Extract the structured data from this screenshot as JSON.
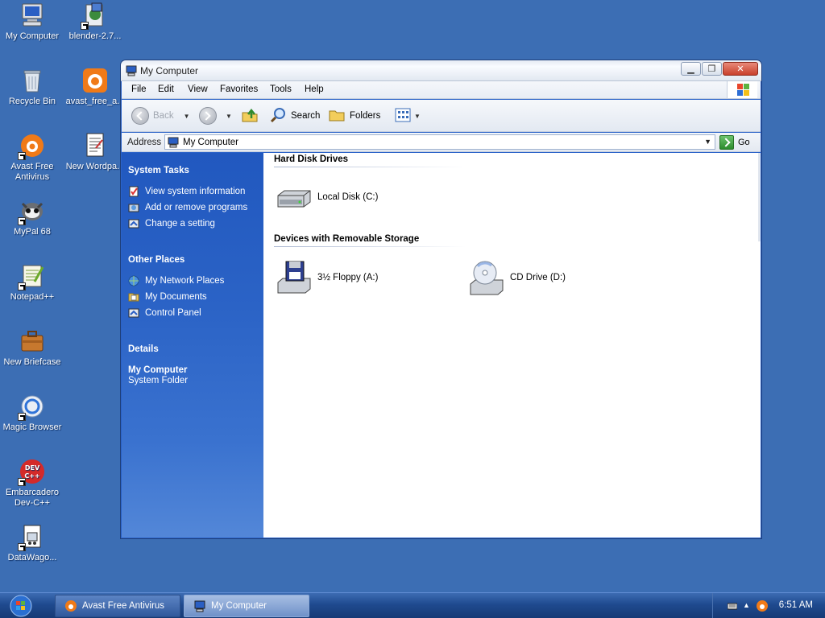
{
  "desktop": {
    "icons": [
      {
        "label": "My Computer",
        "icon": "my-computer-icon"
      },
      {
        "label": "blender-2.7...",
        "icon": "installer-icon"
      },
      {
        "label": "Recycle Bin",
        "icon": "recycle-bin-icon"
      },
      {
        "label": "avast_free_a...",
        "icon": "avast-installer-icon"
      },
      {
        "label": "Avast Free Antivirus",
        "icon": "avast-icon"
      },
      {
        "label": "New Wordpa...",
        "icon": "wordpad-document-icon"
      },
      {
        "label": "MyPal 68",
        "icon": "mypal-browser-icon"
      },
      {
        "label": "Notepad++",
        "icon": "notepadpp-icon"
      },
      {
        "label": "New Briefcase",
        "icon": "briefcase-icon"
      },
      {
        "label": "Magic Browser",
        "icon": "magic-browser-icon"
      },
      {
        "label": "Embarcadero Dev-C++",
        "icon": "devcpp-icon"
      },
      {
        "label": "DataWago...",
        "icon": "datawagon-icon"
      }
    ]
  },
  "window": {
    "title": "My Computer",
    "menu": [
      "File",
      "Edit",
      "View",
      "Favorites",
      "Tools",
      "Help"
    ],
    "toolbar": {
      "back": "Back",
      "search": "Search",
      "folders": "Folders"
    },
    "address": {
      "label": "Address",
      "value": "My Computer",
      "go": "Go"
    },
    "left_pane": {
      "system_tasks": {
        "title": "System Tasks",
        "links": [
          "View system information",
          "Add or remove programs",
          "Change a setting"
        ]
      },
      "other_places": {
        "title": "Other Places",
        "links": [
          "My Network Places",
          "My Documents",
          "Control Panel"
        ]
      },
      "details": {
        "title": "Details",
        "name": "My Computer",
        "type": "System Folder"
      }
    },
    "content": {
      "groups": [
        {
          "title": "Hard Disk Drives",
          "items": [
            {
              "label": "Local Disk (C:)",
              "icon": "hard-disk-icon"
            }
          ]
        },
        {
          "title": "Devices with Removable Storage",
          "items": [
            {
              "label": "3½ Floppy (A:)",
              "icon": "floppy-drive-icon"
            },
            {
              "label": "CD Drive (D:)",
              "icon": "cd-drive-icon"
            }
          ]
        }
      ]
    }
  },
  "taskbar": {
    "tasks": [
      {
        "label": "Avast Free Antivirus",
        "active": false
      },
      {
        "label": "My Computer",
        "active": true
      }
    ],
    "clock": "6:51 AM"
  },
  "colors": {
    "desktop": "#3c6eb4",
    "left_pane": "#2b63c6",
    "taskbar": "#1f4a8f"
  }
}
